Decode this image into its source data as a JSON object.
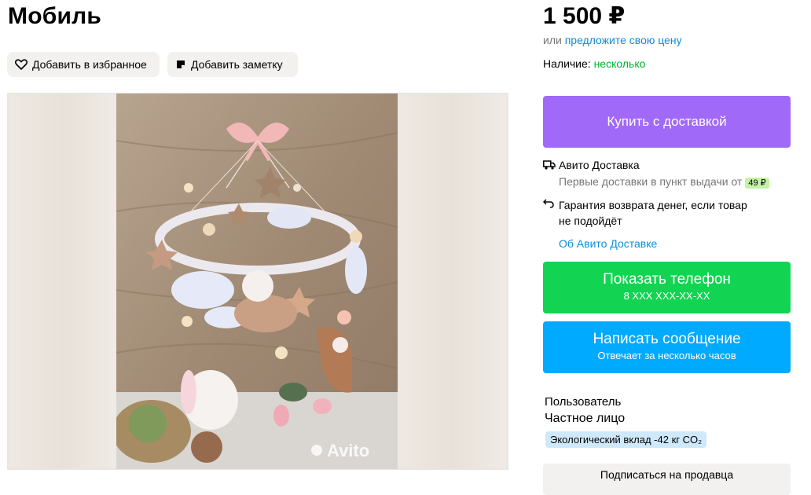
{
  "listing": {
    "title": "Мобиль",
    "favorite_label": "Добавить в избранное",
    "note_label": "Добавить заметку",
    "photo_watermark": "Avito"
  },
  "pricing": {
    "price": "1 500 ₽",
    "offer_prefix": "или",
    "offer_link": "предложите свою цену",
    "availability_label": "Наличие:",
    "availability_value": "несколько"
  },
  "buy_button": "Купить с доставкой",
  "delivery": {
    "title": "Авито Доставка",
    "first_delivery_text": "Первые доставки в пункт выдачи от",
    "first_delivery_price": "49 ₽",
    "guarantee_line1": "Гарантия возврата денег, если товар",
    "guarantee_line2": "не подойдёт",
    "about_link": "Об Авито Доставке"
  },
  "phone_button": {
    "label": "Показать телефон",
    "number": "8 XXX XXX-XX-XX"
  },
  "message_button": {
    "label": "Написать сообщение",
    "subtitle": "Отвечает за несколько часов"
  },
  "seller": {
    "name": "Пользователь",
    "type": "Частное лицо",
    "eco_badge": "Экологический вклад -42 кг CO₂",
    "subscribe_label": "Подписаться на продавца"
  },
  "colors": {
    "buy": "#a169f7",
    "phone": "#12d452",
    "message": "#00aaff",
    "link": "#0a8edb",
    "in_stock": "#02b22c"
  },
  "icons": [
    "heart-icon",
    "note-icon",
    "truck-icon",
    "return-icon"
  ]
}
